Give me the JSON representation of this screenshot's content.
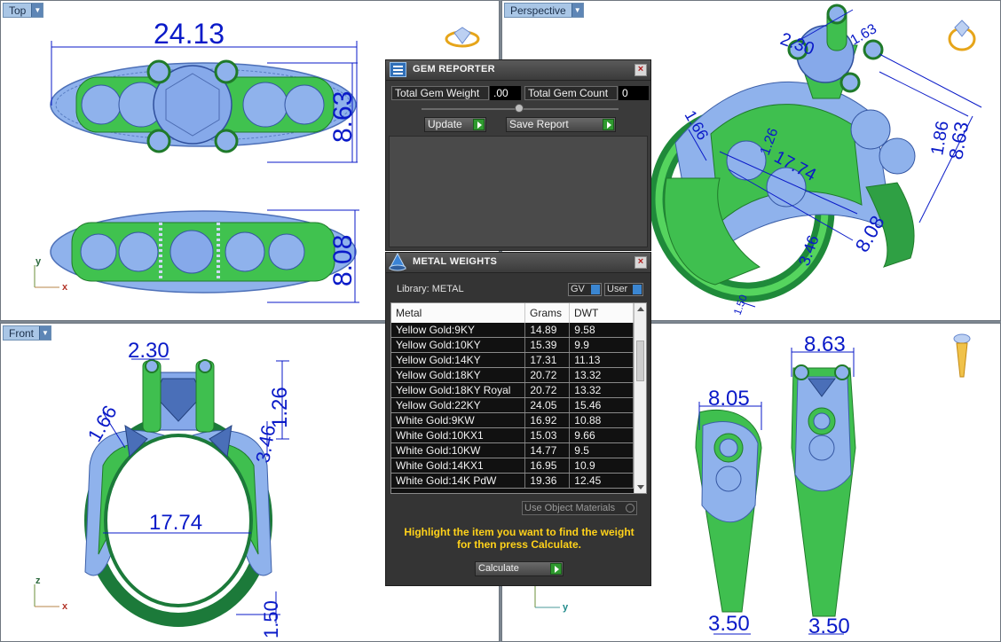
{
  "viewports": {
    "top": {
      "label": "Top",
      "dims": {
        "width": "24.13",
        "height_upper": "8.63",
        "height_lower": "8.08"
      },
      "axes": {
        "a": "y",
        "b": "x"
      }
    },
    "perspective": {
      "label": "Perspective",
      "dims": {
        "d1": "2.30",
        "d2": "1.63",
        "d3": "1.66",
        "d4": "17.74",
        "d5": "1.86",
        "d6": "8.63",
        "d7": "8.08",
        "d8": "1.50",
        "d9": "3.46",
        "d10": "1.26"
      }
    },
    "front": {
      "label": "Front",
      "dims": {
        "top": "2.30",
        "left": "1.66",
        "right_a": "1.26",
        "right_b": "3.46",
        "inner": "17.74",
        "bottom": "1.50"
      },
      "axes": {
        "a": "z",
        "b": "x"
      }
    },
    "side": {
      "dims": {
        "left_top": "8.05",
        "right_top": "8.63",
        "left_bottom": "3.50",
        "right_bottom": "3.50"
      },
      "axes": {
        "a": "z",
        "b": "y"
      }
    }
  },
  "gem_reporter": {
    "title": "GEM REPORTER",
    "close": "×",
    "total_weight_label": "Total Gem Weight",
    "total_weight_value": ".00",
    "total_count_label": "Total Gem Count",
    "total_count_value": "0",
    "update_label": "Update",
    "save_label": "Save Report"
  },
  "metal_weights": {
    "title": "METAL WEIGHTS",
    "close": "×",
    "library_label": "Library: METAL",
    "gv_label": "GV",
    "user_label": "User",
    "columns": {
      "metal": "Metal",
      "grams": "Grams",
      "dwt": "DWT"
    },
    "rows": [
      {
        "metal": "Yellow Gold:9KY",
        "grams": "14.89",
        "dwt": "9.58"
      },
      {
        "metal": "Yellow Gold:10KY",
        "grams": "15.39",
        "dwt": "9.9"
      },
      {
        "metal": "Yellow Gold:14KY",
        "grams": "17.31",
        "dwt": "11.13"
      },
      {
        "metal": "Yellow Gold:18KY",
        "grams": "20.72",
        "dwt": "13.32"
      },
      {
        "metal": "Yellow Gold:18KY Royal",
        "grams": "20.72",
        "dwt": "13.32"
      },
      {
        "metal": "Yellow Gold:22KY",
        "grams": "24.05",
        "dwt": "15.46"
      },
      {
        "metal": "White Gold:9KW",
        "grams": "16.92",
        "dwt": "10.88"
      },
      {
        "metal": "White Gold:10KX1",
        "grams": "15.03",
        "dwt": "9.66"
      },
      {
        "metal": "White Gold:10KW",
        "grams": "14.77",
        "dwt": "9.5"
      },
      {
        "metal": "White Gold:14KX1",
        "grams": "16.95",
        "dwt": "10.9"
      },
      {
        "metal": "White Gold:14K PdW",
        "grams": "19.36",
        "dwt": "12.45"
      }
    ],
    "use_object_label": "Use Object Materials",
    "hint": "Highlight the item you want to find the weight for then press Calculate.",
    "calculate_label": "Calculate"
  },
  "colors": {
    "dimension": "#0a1ac8",
    "gem": "#7fa6e8",
    "metal": "#3fbf4f",
    "hint": "#ffd21a"
  }
}
